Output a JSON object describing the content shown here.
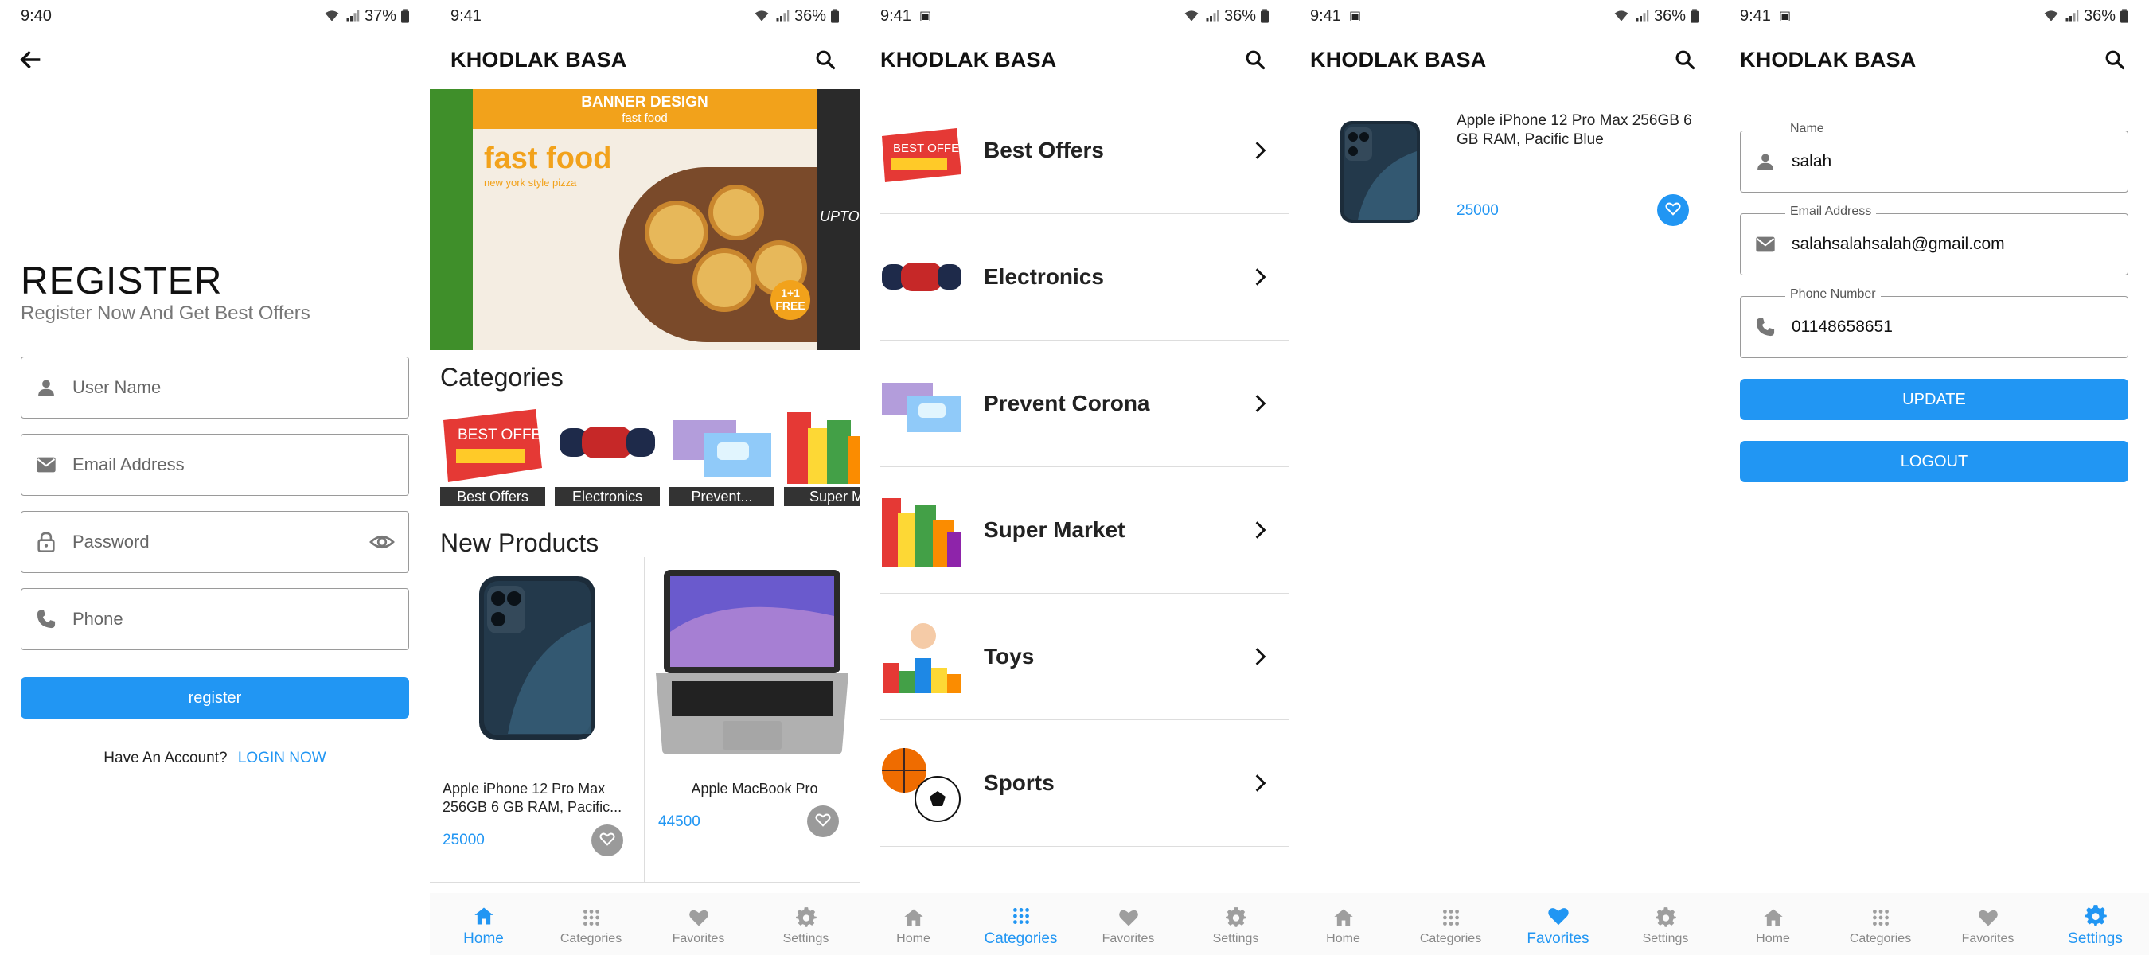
{
  "colors": {
    "accent": "#2196f3",
    "nav_inactive": "#9e9e9e",
    "heart_inactive": "#9a9a9a",
    "text": "#111111",
    "muted": "#777777"
  },
  "screens": {
    "register": {
      "status": {
        "time": "9:40",
        "battery": "37%"
      },
      "title": "REGISTER",
      "subtitle": "Register Now And Get Best Offers",
      "fields": [
        {
          "placeholder": "User Name",
          "icon": "person-icon"
        },
        {
          "placeholder": "Email Address",
          "icon": "email-icon"
        },
        {
          "placeholder": "Password",
          "icon": "lock-icon",
          "trailing_icon": "eye-icon"
        },
        {
          "placeholder": "Phone",
          "icon": "phone-icon"
        }
      ],
      "register_button": "register",
      "have_account": "Have An Account?",
      "login_link": "LOGIN NOW"
    },
    "home": {
      "status": {
        "time": "9:41",
        "battery": "36%"
      },
      "app_title": "KHODLAK BASA",
      "banner": {
        "header": "BANNER DESIGN",
        "subheader": "fast food",
        "headline": "fast food",
        "tagline": "new york style pizza",
        "side_text": "UPTO",
        "badge": "1+1 FREE"
      },
      "categories_title": "Categories",
      "categories": [
        "Best Offers",
        "Electronics",
        "Prevent...",
        "Super M"
      ],
      "new_products_title": "New Products",
      "products": [
        {
          "name": "Apple iPhone 12 Pro Max 256GB 6 GB RAM, Pacific...",
          "price": "25000"
        },
        {
          "name": "Apple MacBook Pro",
          "price": "44500"
        }
      ]
    },
    "categories": {
      "status": {
        "time": "9:41",
        "battery": "36%"
      },
      "app_title": "KHODLAK BASA",
      "items": [
        "Best Offers",
        "Electronics",
        "Prevent Corona",
        "Super Market",
        "Toys",
        "Sports"
      ]
    },
    "favorites": {
      "status": {
        "time": "9:41",
        "battery": "36%"
      },
      "app_title": "KHODLAK BASA",
      "items": [
        {
          "name": "Apple iPhone 12 Pro Max 256GB 6 GB RAM, Pacific Blue",
          "price": "25000",
          "favorite": true
        }
      ]
    },
    "settings": {
      "status": {
        "time": "9:41",
        "battery": "36%"
      },
      "app_title": "KHODLAK BASA",
      "fields": [
        {
          "label": "Name",
          "value": "salah",
          "icon": "person-icon"
        },
        {
          "label": "Email Address",
          "value": "salahsalahsalah@gmail.com",
          "icon": "email-icon"
        },
        {
          "label": "Phone Number",
          "value": "01148658651",
          "icon": "phone-icon"
        }
      ],
      "update_button": "UPDATE",
      "logout_button": "LOGOUT"
    }
  },
  "bottom_nav": {
    "items": [
      {
        "label": "Home",
        "icon": "home-icon"
      },
      {
        "label": "Categories",
        "icon": "apps-icon"
      },
      {
        "label": "Favorites",
        "icon": "heart-icon"
      },
      {
        "label": "Settings",
        "icon": "gear-icon"
      }
    ],
    "active_by_screen": {
      "home": "Home",
      "categories": "Categories",
      "favorites": "Favorites",
      "settings": "Settings"
    }
  }
}
